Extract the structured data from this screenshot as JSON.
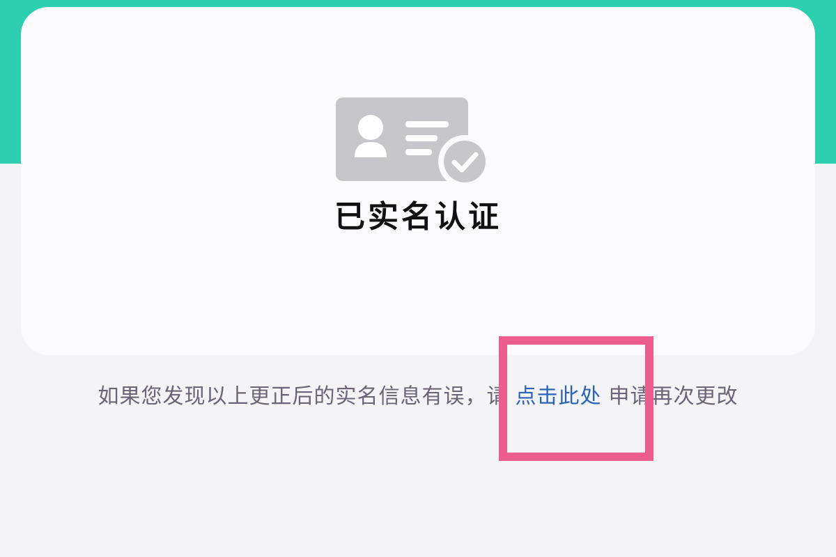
{
  "status": {
    "title": "已实名认证",
    "icon": "id-card-verified-icon"
  },
  "notice": {
    "prefix": "如果您发现以上更正后的实名信息有误，请",
    "link_label": "点击此处",
    "suffix": "申请再次更改"
  },
  "colors": {
    "header": "#2ecfb0",
    "link": "#2b63b6",
    "highlight": "#ec5c8c"
  }
}
